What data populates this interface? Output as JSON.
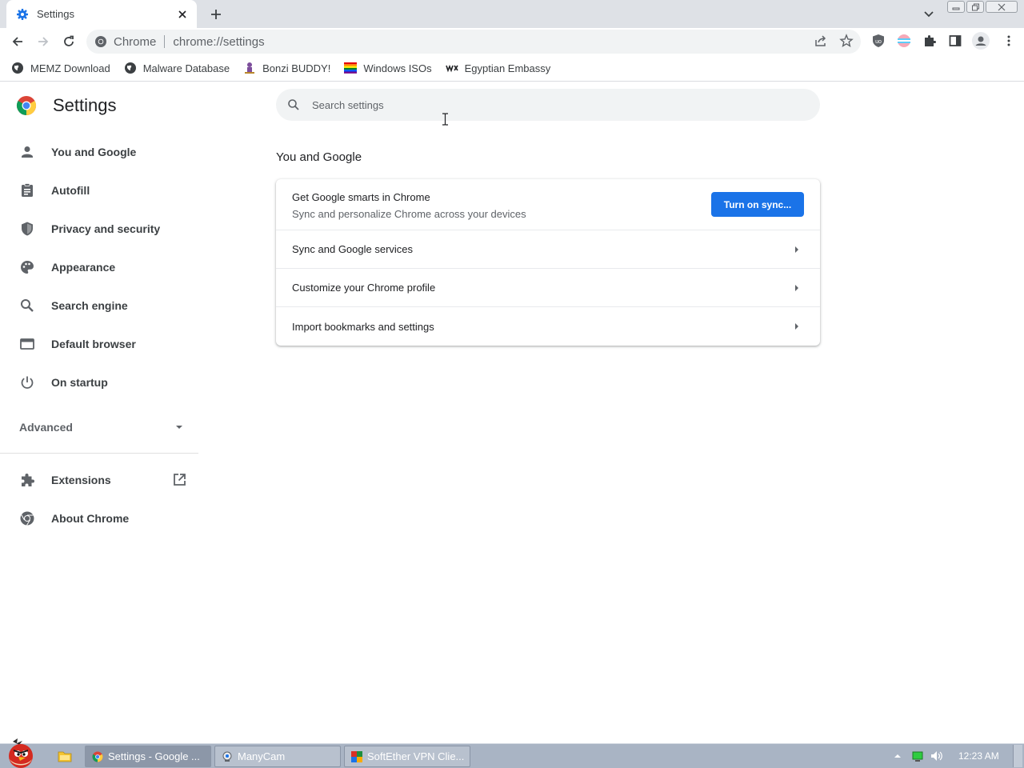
{
  "browser": {
    "tab": {
      "title": "Settings"
    },
    "omnibox": {
      "chip": "Chrome",
      "url": "chrome://settings"
    },
    "bookmarks": [
      {
        "label": "MEMZ Download"
      },
      {
        "label": "Malware Database"
      },
      {
        "label": "Bonzi BUDDY!"
      },
      {
        "label": "Windows ISOs"
      },
      {
        "label": "Egyptian Embassy"
      }
    ]
  },
  "settings": {
    "title": "Settings",
    "search": {
      "placeholder": "Search settings"
    },
    "nav": [
      {
        "label": "You and Google",
        "icon": "person-icon"
      },
      {
        "label": "Autofill",
        "icon": "clipboard-icon"
      },
      {
        "label": "Privacy and security",
        "icon": "shield-icon"
      },
      {
        "label": "Appearance",
        "icon": "palette-icon"
      },
      {
        "label": "Search engine",
        "icon": "search-icon"
      },
      {
        "label": "Default browser",
        "icon": "browser-window-icon"
      },
      {
        "label": "On startup",
        "icon": "power-icon"
      }
    ],
    "advanced": "Advanced",
    "nav_bottom": [
      {
        "label": "Extensions",
        "icon": "puzzle-icon"
      },
      {
        "label": "About Chrome",
        "icon": "chrome-icon"
      }
    ],
    "section": {
      "title": "You and Google",
      "sync_primary": "Get Google smarts in Chrome",
      "sync_secondary": "Sync and personalize Chrome across your devices",
      "sync_button": "Turn on sync...",
      "rows": [
        "Sync and Google services",
        "Customize your Chrome profile",
        "Import bookmarks and settings"
      ]
    }
  },
  "taskbar": {
    "tasks": [
      {
        "label": "Settings - Google ..."
      },
      {
        "label": "ManyCam"
      },
      {
        "label": "SoftEther VPN Clie..."
      }
    ],
    "clock": "12:23 AM"
  },
  "colors": {
    "accent": "#1a73e8",
    "tabstrip": "#dee1e6",
    "taskbar": "#a9b4c4"
  }
}
